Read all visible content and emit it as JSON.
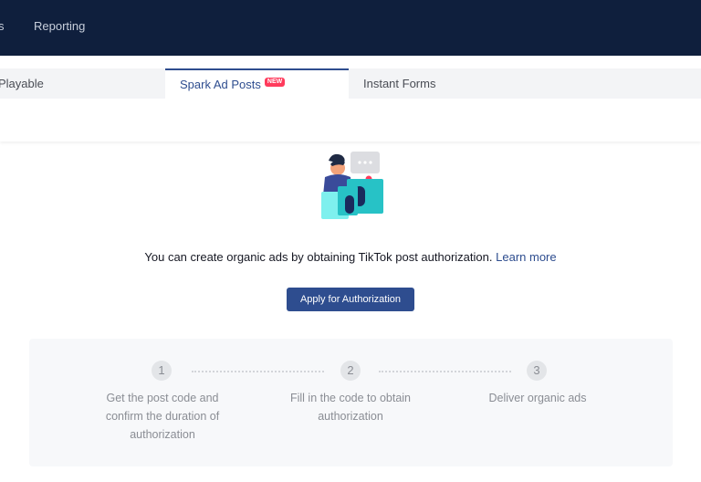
{
  "topbar": {
    "nav_items": [
      {
        "label": "s"
      },
      {
        "label": "Reporting"
      }
    ]
  },
  "tabs": [
    {
      "label": "Playable"
    },
    {
      "label": "Spark Ad Posts",
      "badge": "NEW"
    },
    {
      "label": "Instant Forms"
    }
  ],
  "empty_state": {
    "message": "You can create organic ads by obtaining TikTok post authorization.",
    "learn_more": "Learn more",
    "button_label": "Apply for Authorization"
  },
  "steps": [
    {
      "number": "1",
      "lines": [
        "Get the post code and",
        "confirm the duration of",
        "authorization"
      ]
    },
    {
      "number": "2",
      "lines": [
        "Fill in the code to obtain",
        "authorization"
      ]
    },
    {
      "number": "3",
      "lines": [
        "Deliver organic ads"
      ]
    }
  ],
  "colors": {
    "topbar_bg": "#0f1f3d",
    "accent": "#2e4d8f",
    "badge": "#ff3b5c"
  }
}
